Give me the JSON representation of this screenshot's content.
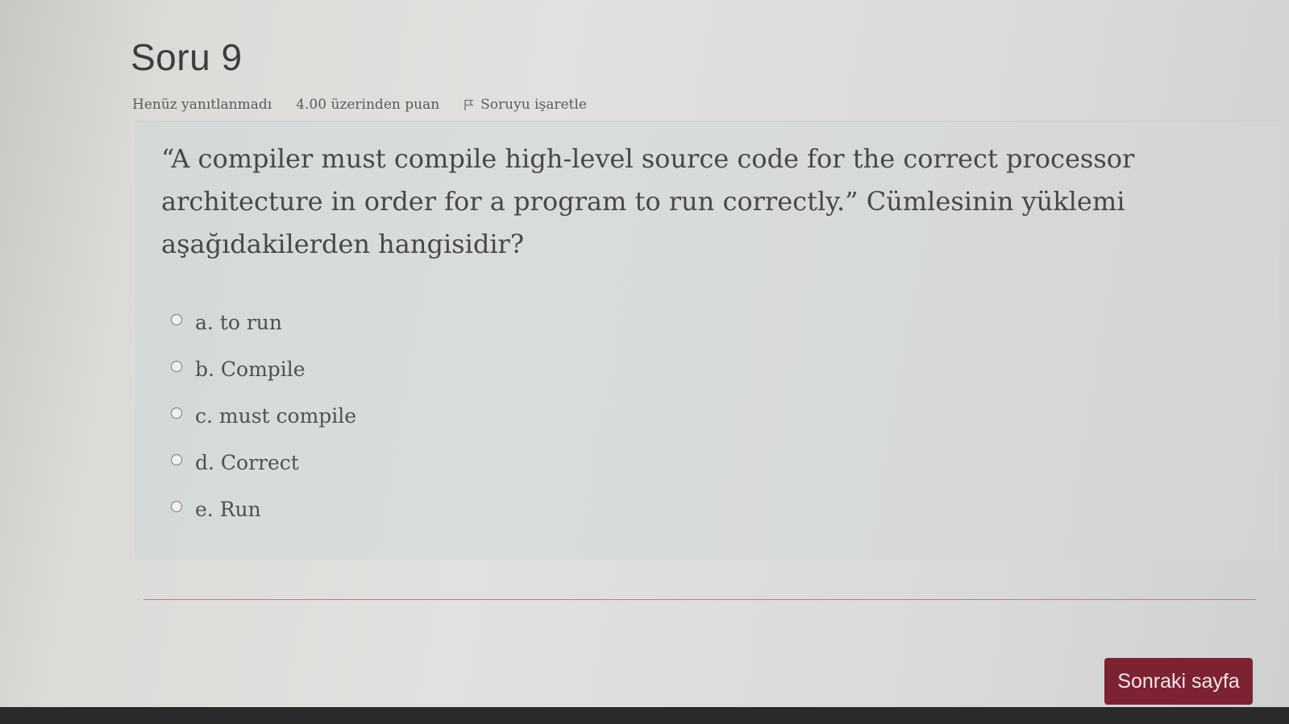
{
  "question": {
    "title": "Soru 9",
    "status": "Henüz yanıtlanmadı",
    "points": "4.00 üzerinden puan",
    "flag_label": "Soruyu işaretle",
    "text": "“A compiler must compile high-level source code for the correct processor architecture in order for a program to run correctly.” Cümlesinin yüklemi aşağıdakilerden hangisidir?"
  },
  "answers": [
    {
      "label": "a. to run"
    },
    {
      "label": "b. Compile"
    },
    {
      "label": "c. must compile"
    },
    {
      "label": "d. Correct"
    },
    {
      "label": "e. Run"
    }
  ],
  "navigation": {
    "next_label": "Sonraki sayfa"
  },
  "colors": {
    "primary_button": "#7d2232"
  },
  "icons": {
    "flag": "flag-icon",
    "radio": "radio-unchecked-icon"
  }
}
